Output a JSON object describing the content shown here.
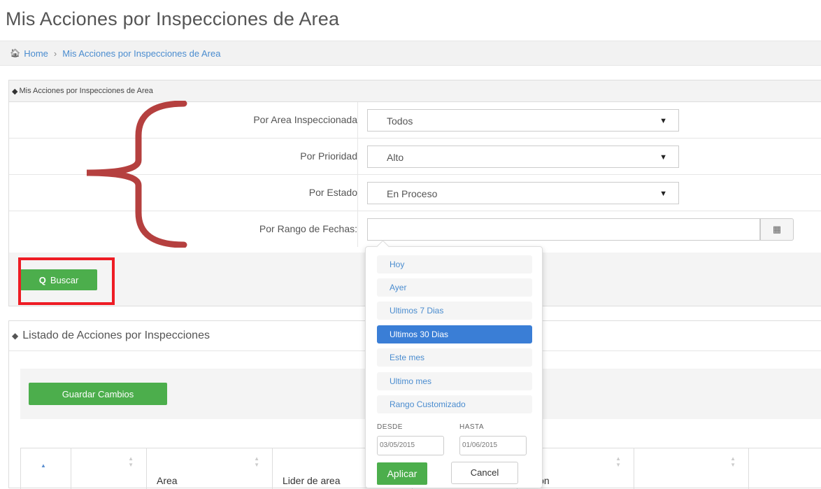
{
  "page": {
    "title": "Mis Acciones por Inspecciones de Area"
  },
  "breadcrumb": {
    "home": "Home",
    "current": "Mis Acciones por Inspecciones de Area"
  },
  "filters_panel": {
    "title": "Mis Acciones por Inspecciones de Area",
    "filters": [
      {
        "label": "Por Area Inspeccionada",
        "value": "Todos"
      },
      {
        "label": "Por Prioridad",
        "value": "Alto"
      },
      {
        "label": "Por Estado",
        "value": "En Proceso"
      }
    ],
    "date_range": {
      "label": "Por Rango de Fechas:",
      "value": ""
    },
    "search_button": "Buscar"
  },
  "list_panel": {
    "title": "Listado de Acciones por Inspecciones",
    "save_button": "Guardar Cambios",
    "columns": [
      "",
      "",
      "Area",
      "Lider de area",
      "",
      "ción",
      "",
      ""
    ]
  },
  "date_dropdown": {
    "ranges": [
      "Hoy",
      "Ayer",
      "Ultimos 7 Dias",
      "Ultimos 30 Dias",
      "Este mes",
      "Ultimo mes",
      "Rango Customizado"
    ],
    "active_index": 3,
    "from_label": "DESDE",
    "to_label": "HASTA",
    "from_value": "03/05/2015",
    "to_value": "01/06/2015",
    "apply_button": "Aplicar",
    "cancel_button": "Cancel"
  },
  "colors": {
    "accent": "#4cae4c",
    "link": "#4a8ccf",
    "active_range": "#3a7ed6",
    "annotation_red": "#ee1c24",
    "brace": "#b5403f"
  }
}
